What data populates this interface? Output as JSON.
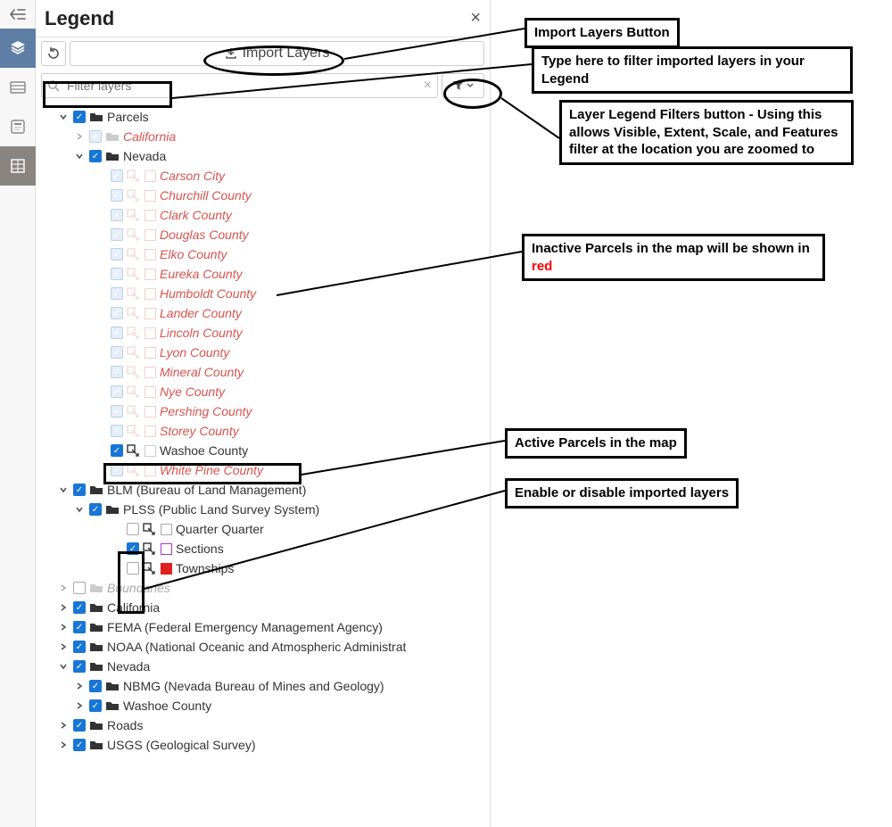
{
  "sidebar": {
    "items": [
      {
        "name": "collapse-icon"
      },
      {
        "name": "layers-icon",
        "active": true
      },
      {
        "name": "table-icon"
      },
      {
        "name": "info-icon"
      },
      {
        "name": "grid-icon"
      }
    ]
  },
  "panel": {
    "title": "Legend",
    "close": "×",
    "reset_tooltip": "Reset",
    "import_label": "Import Layers",
    "filter_placeholder": "Filter layers"
  },
  "tree": {
    "parcels": "Parcels",
    "california": "California",
    "nevada": "Nevada",
    "nevada_counties": [
      "Carson City",
      "Churchill County",
      "Clark County",
      "Douglas County",
      "Elko County",
      "Eureka County",
      "Humboldt County",
      "Lander County",
      "Lincoln County",
      "Lyon County",
      "Mineral County",
      "Nye County",
      "Pershing County",
      "Storey County"
    ],
    "washoe": "Washoe County",
    "white_pine": "White Pine County",
    "blm": "BLM (Bureau of Land Management)",
    "plss": "PLSS (Public Land Survey System)",
    "quarter": "Quarter Quarter",
    "sections": "Sections",
    "townships": "Townships",
    "boundaries": "Boundaries",
    "california2": "California",
    "fema": "FEMA (Federal Emergency Management Agency)",
    "noaa": "NOAA (National Oceanic and Atmospheric Administrat",
    "nevada2": "Nevada",
    "nbmg": "NBMG (Nevada Bureau of Mines and Geology)",
    "washoe2": "Washoe County",
    "roads": "Roads",
    "usgs": "USGS (Geological Survey)"
  },
  "callouts": {
    "import": "Import Layers Button",
    "filter": "Type here to filter imported layers in your Legend",
    "funnel": "Layer Legend Filters button - Using this allows Visible, Extent, Scale, and Features filter at the location you are zoomed to",
    "inactive_a": "Inactive Parcels in the map will be shown in ",
    "inactive_b": "red",
    "active": "Active Parcels in the map",
    "enable": "Enable or disable imported layers"
  }
}
